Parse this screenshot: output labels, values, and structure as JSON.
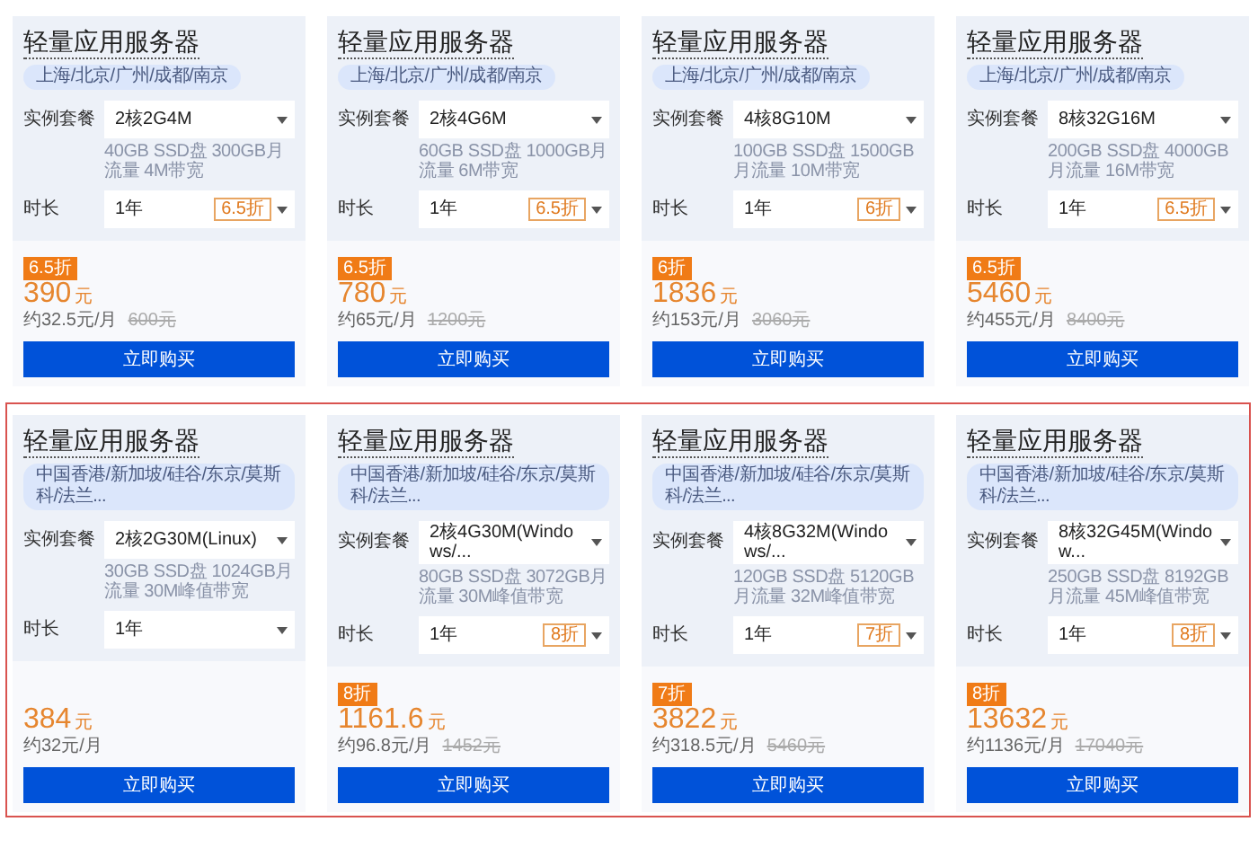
{
  "groups": [
    {
      "highlighted": false,
      "cards": [
        {
          "title": "轻量应用服务器",
          "regions": "上海/北京/广州/成都/南京",
          "plan_label": "实例套餐",
          "plan": "2核2G4M",
          "plan_desc": "40GB SSD盘 300GB月流量 4M带宽",
          "duration_label": "时长",
          "duration": "1年",
          "duration_tag": "6.5折",
          "badge": "6.5折",
          "price": "390",
          "unit": "元",
          "monthly": "约32.5元/月",
          "original_price": "600元",
          "button": "立即购买"
        },
        {
          "title": "轻量应用服务器",
          "regions": "上海/北京/广州/成都/南京",
          "plan_label": "实例套餐",
          "plan": "2核4G6M",
          "plan_desc": "60GB SSD盘 1000GB月流量 6M带宽",
          "duration_label": "时长",
          "duration": "1年",
          "duration_tag": "6.5折",
          "badge": "6.5折",
          "price": "780",
          "unit": "元",
          "monthly": "约65元/月",
          "original_price": "1200元",
          "button": "立即购买"
        },
        {
          "title": "轻量应用服务器",
          "regions": "上海/北京/广州/成都/南京",
          "plan_label": "实例套餐",
          "plan": "4核8G10M",
          "plan_desc": "100GB SSD盘 1500GB月流量 10M带宽",
          "duration_label": "时长",
          "duration": "1年",
          "duration_tag": "6折",
          "badge": "6折",
          "price": "1836",
          "unit": "元",
          "monthly": "约153元/月",
          "original_price": "3060元",
          "button": "立即购买"
        },
        {
          "title": "轻量应用服务器",
          "regions": "上海/北京/广州/成都/南京",
          "plan_label": "实例套餐",
          "plan": "8核32G16M",
          "plan_desc": "200GB SSD盘 4000GB月流量 16M带宽",
          "duration_label": "时长",
          "duration": "1年",
          "duration_tag": "6.5折",
          "badge": "6.5折",
          "price": "5460",
          "unit": "元",
          "monthly": "约455元/月",
          "original_price": "8400元",
          "button": "立即购买"
        }
      ]
    },
    {
      "highlighted": true,
      "cards": [
        {
          "title": "轻量应用服务器",
          "regions": "中国香港/新加坡/硅谷/东京/莫斯科/法兰...",
          "plan_label": "实例套餐",
          "plan": "2核2G30M(Linux)",
          "plan_desc": "30GB SSD盘 1024GB月流量 30M峰值带宽",
          "duration_label": "时长",
          "duration": "1年",
          "price": "384",
          "unit": "元",
          "monthly": "约32元/月",
          "button": "立即购买"
        },
        {
          "title": "轻量应用服务器",
          "regions": "中国香港/新加坡/硅谷/东京/莫斯科/法兰...",
          "plan_label": "实例套餐",
          "plan": "2核4G30M(Windows/...",
          "plan_desc": "80GB SSD盘 3072GB月流量 30M峰值带宽",
          "duration_label": "时长",
          "duration": "1年",
          "duration_tag": "8折",
          "badge": "8折",
          "price": "1161.6",
          "unit": "元",
          "monthly": "约96.8元/月",
          "original_price": "1452元",
          "button": "立即购买"
        },
        {
          "title": "轻量应用服务器",
          "regions": "中国香港/新加坡/硅谷/东京/莫斯科/法兰...",
          "plan_label": "实例套餐",
          "plan": "4核8G32M(Windows/...",
          "plan_desc": "120GB SSD盘 5120GB月流量 32M峰值带宽",
          "duration_label": "时长",
          "duration": "1年",
          "duration_tag": "7折",
          "badge": "7折",
          "price": "3822",
          "unit": "元",
          "monthly": "约318.5元/月",
          "original_price": "5460元",
          "button": "立即购买"
        },
        {
          "title": "轻量应用服务器",
          "regions": "中国香港/新加坡/硅谷/东京/莫斯科/法兰...",
          "plan_label": "实例套餐",
          "plan": "8核32G45M(Window...",
          "plan_desc": "250GB SSD盘 8192GB月流量 45M峰值带宽",
          "duration_label": "时长",
          "duration": "1年",
          "duration_tag": "8折",
          "badge": "8折",
          "price": "13632",
          "unit": "元",
          "monthly": "约1136元/月",
          "original_price": "17040元",
          "button": "立即购买"
        }
      ]
    }
  ]
}
